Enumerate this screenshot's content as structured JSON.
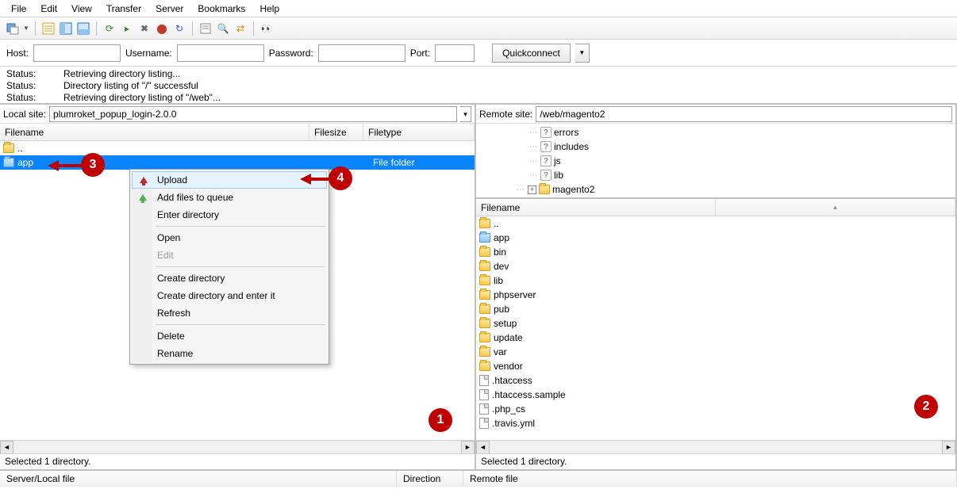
{
  "menu": {
    "items": [
      "File",
      "Edit",
      "View",
      "Transfer",
      "Server",
      "Bookmarks",
      "Help"
    ]
  },
  "quickbar": {
    "host_label": "Host:",
    "user_label": "Username:",
    "pass_label": "Password:",
    "port_label": "Port:",
    "connect_label": "Quickconnect"
  },
  "log": [
    {
      "label": "Status:",
      "msg": "Retrieving directory listing..."
    },
    {
      "label": "Status:",
      "msg": "Directory listing of \"/\" successful"
    },
    {
      "label": "Status:",
      "msg": "Retrieving directory listing of \"/web\"..."
    }
  ],
  "local": {
    "path_label": "Local site:",
    "path": "plumroket_popup_login-2.0.0",
    "cols": {
      "name": "Filename",
      "size": "Filesize",
      "type": "Filetype"
    },
    "rows": [
      {
        "name": "..",
        "type": "",
        "icon": "folder"
      },
      {
        "name": "app",
        "type": "File folder",
        "icon": "folder-blue",
        "selected": true
      }
    ],
    "status": "Selected 1 directory."
  },
  "remote": {
    "path_label": "Remote site:",
    "path": "/web/magento2",
    "tree": [
      {
        "indent": 60,
        "icon": "q",
        "label": "errors"
      },
      {
        "indent": 60,
        "icon": "q",
        "label": "includes"
      },
      {
        "indent": 60,
        "icon": "q",
        "label": "js"
      },
      {
        "indent": 60,
        "icon": "q",
        "label": "lib"
      },
      {
        "indent": 44,
        "icon": "folder",
        "label": "magento2",
        "expander": "+"
      }
    ],
    "cols": {
      "name": "Filename"
    },
    "rows": [
      {
        "name": "..",
        "icon": "folder"
      },
      {
        "name": "app",
        "icon": "folder-blue"
      },
      {
        "name": "bin",
        "icon": "folder"
      },
      {
        "name": "dev",
        "icon": "folder"
      },
      {
        "name": "lib",
        "icon": "folder"
      },
      {
        "name": "phpserver",
        "icon": "folder"
      },
      {
        "name": "pub",
        "icon": "folder"
      },
      {
        "name": "setup",
        "icon": "folder"
      },
      {
        "name": "update",
        "icon": "folder"
      },
      {
        "name": "var",
        "icon": "folder"
      },
      {
        "name": "vendor",
        "icon": "folder"
      },
      {
        "name": ".htaccess",
        "icon": "file"
      },
      {
        "name": ".htaccess.sample",
        "icon": "file"
      },
      {
        "name": ".php_cs",
        "icon": "file"
      },
      {
        "name": ".travis.yml",
        "icon": "file"
      }
    ],
    "status": "Selected 1 directory."
  },
  "context_menu": {
    "items": [
      {
        "label": "Upload",
        "icon": "up-red",
        "hover": true
      },
      {
        "label": "Add files to queue",
        "icon": "up-green"
      },
      {
        "label": "Enter directory"
      },
      {
        "sep": true
      },
      {
        "label": "Open"
      },
      {
        "label": "Edit",
        "disabled": true
      },
      {
        "sep": true
      },
      {
        "label": "Create directory"
      },
      {
        "label": "Create directory and enter it"
      },
      {
        "label": "Refresh"
      },
      {
        "sep": true
      },
      {
        "label": "Delete"
      },
      {
        "label": "Rename"
      }
    ]
  },
  "transfer_cols": {
    "local": "Server/Local file",
    "dir": "Direction",
    "remote": "Remote file"
  },
  "badges": {
    "b1": "1",
    "b2": "2",
    "b3": "3",
    "b4": "4"
  }
}
